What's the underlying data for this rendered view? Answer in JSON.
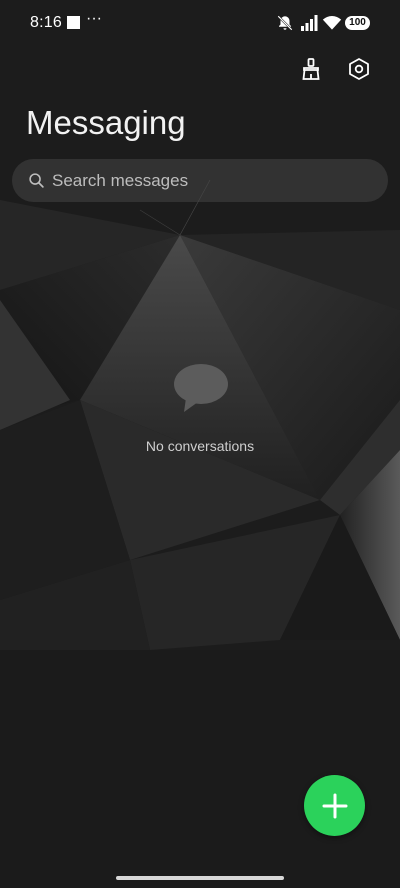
{
  "status_bar": {
    "time": "8:16",
    "overflow": "···",
    "battery": "100",
    "icons": [
      "notifications-off-icon",
      "signal-icon",
      "wifi-icon",
      "battery-icon"
    ]
  },
  "toolbar": {
    "actions": [
      "clean-brush-icon",
      "settings-icon"
    ]
  },
  "app": {
    "title": "Messaging"
  },
  "search": {
    "placeholder": "Search messages"
  },
  "empty_state": {
    "icon": "chat-bubble-icon",
    "text": "No conversations"
  },
  "fab": {
    "icon": "plus-icon"
  },
  "colors": {
    "background": "#1b1b1b",
    "fab": "#2bd25b",
    "search_bg": "#464646"
  }
}
